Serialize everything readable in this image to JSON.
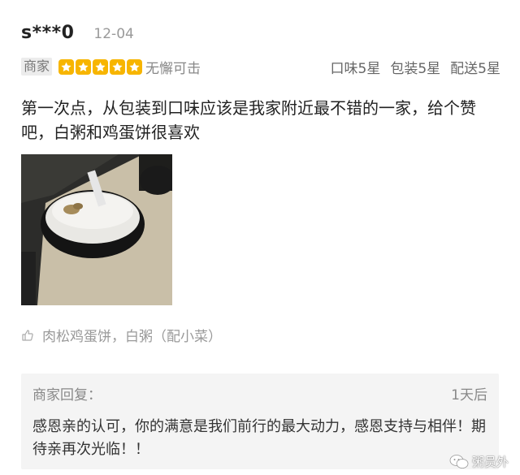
{
  "review": {
    "username": "s***0",
    "date": "12-04",
    "merchant_label": "商家",
    "stars": 5,
    "rating_text": "无懈可击",
    "sub_ratings": [
      "口味5星",
      "包装5星",
      "配送5星"
    ],
    "comment": "第一次点，从包装到口味应该是我家附近最不错的一家，给个赞吧，白粥和鸡蛋饼很喜欢",
    "dishes": "肉松鸡蛋饼，白粥（配小菜）",
    "icons": {
      "star": "star-icon",
      "thumb": "thumbs-up-icon",
      "watermark": "wechat-icon"
    },
    "colors": {
      "star": "#f7b500",
      "reply_bg": "#f4f4f4"
    }
  },
  "reply": {
    "label": "商家回复：",
    "time": "1天后",
    "text": "感恩亲的认可，你的满意是我们前行的最大动力，感恩支持与相伴！期待亲再次光临！！"
  },
  "watermark": {
    "text": "粥员外"
  }
}
